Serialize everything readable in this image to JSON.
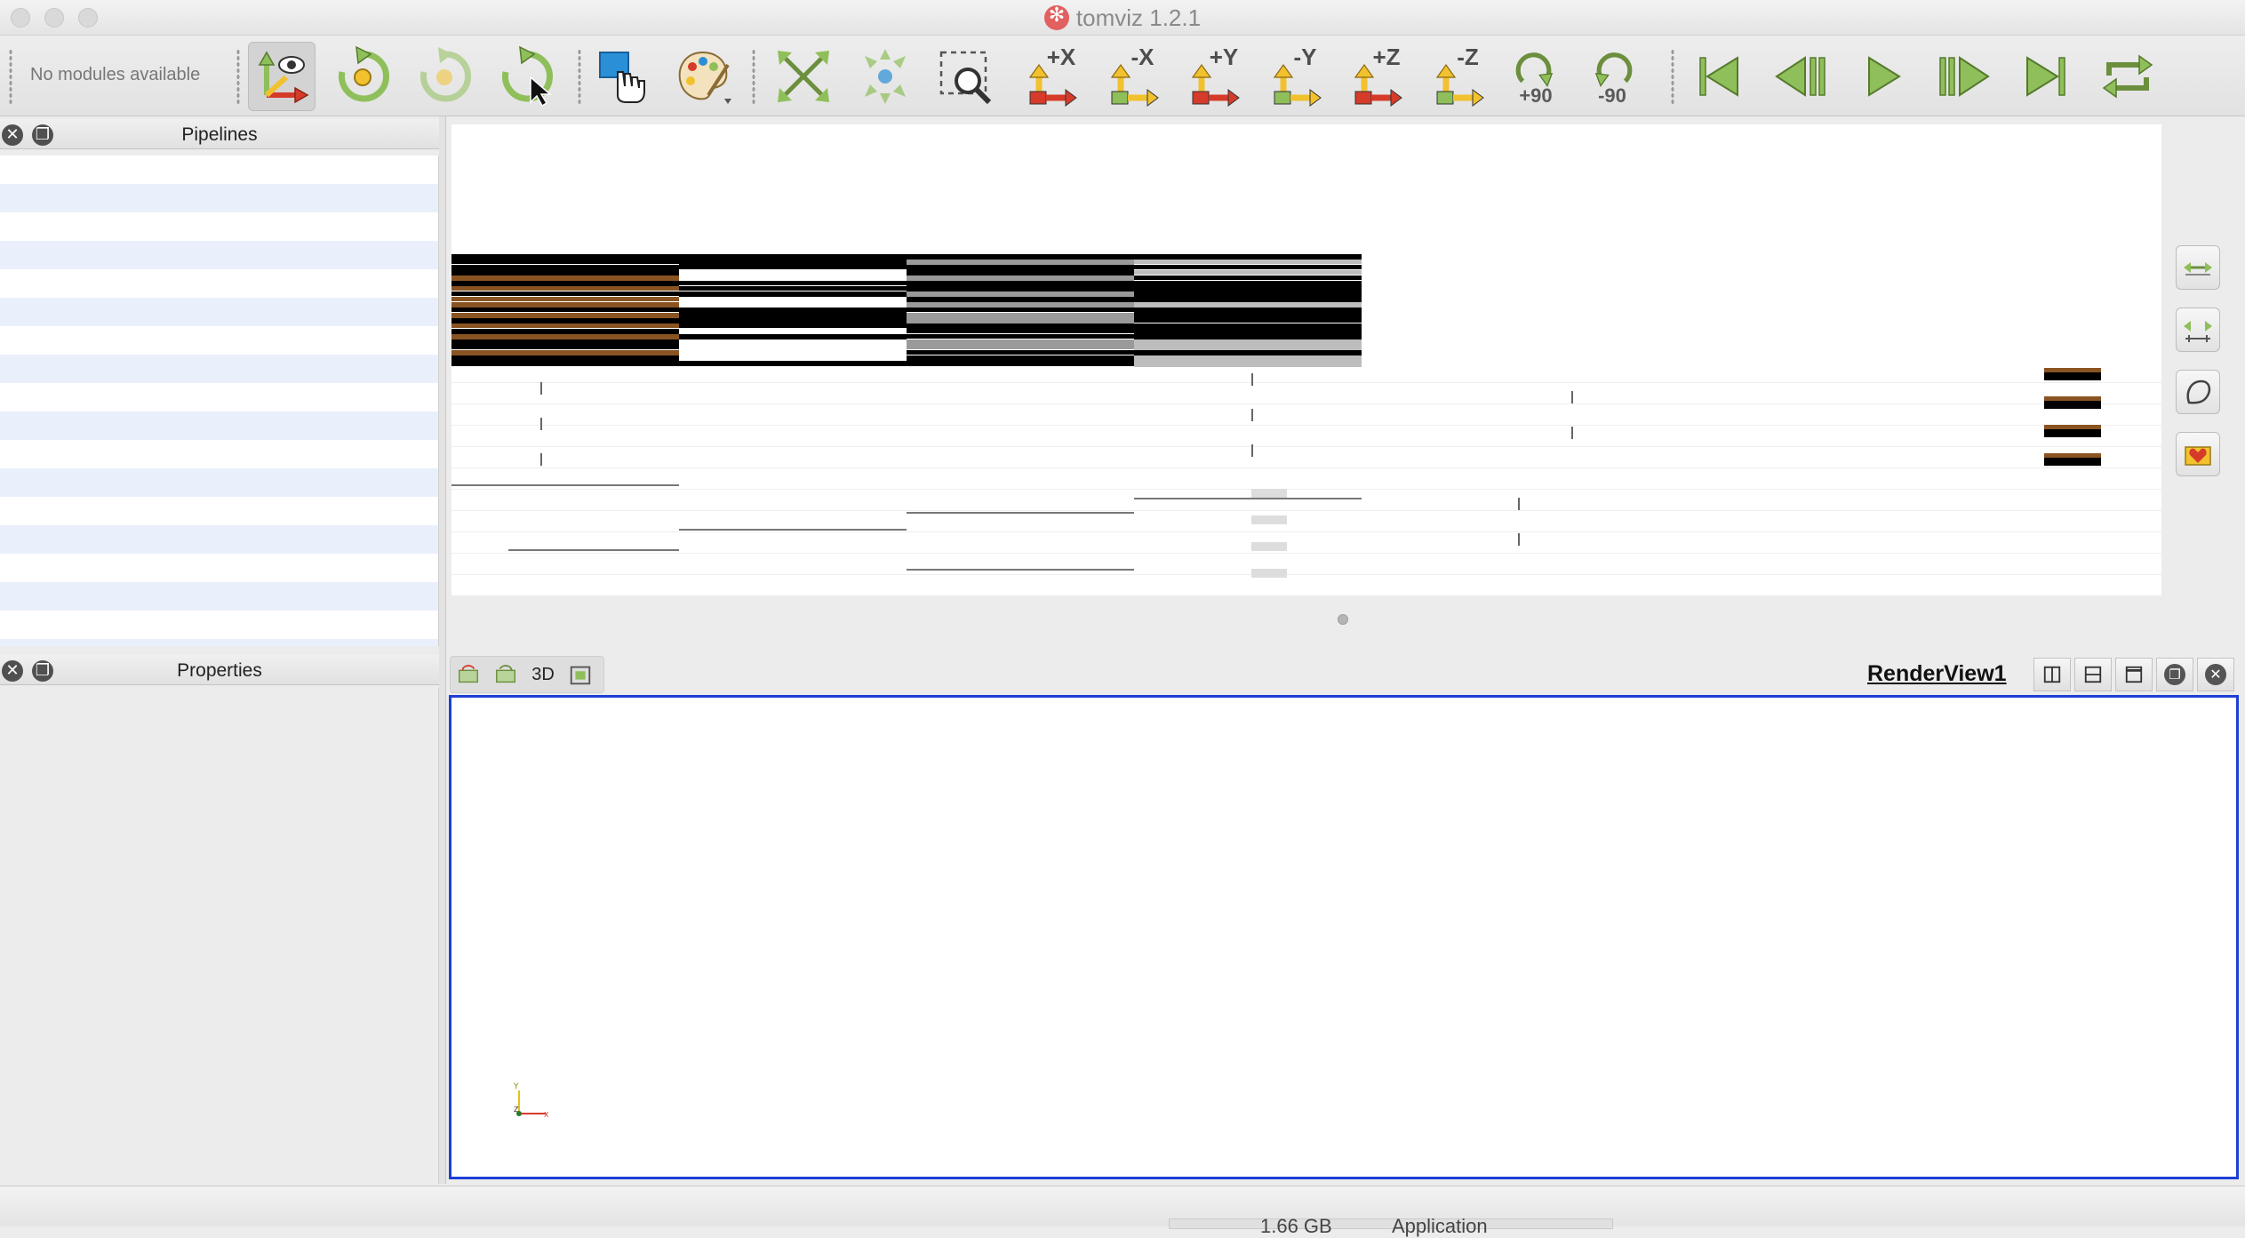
{
  "window": {
    "title": "tomviz 1.2.1"
  },
  "toolbar": {
    "modules_label": "No modules available",
    "buttons": [
      {
        "name": "Interact",
        "icon": "eye-axes-icon"
      },
      {
        "name": "Reset camera",
        "icon": "reset-camera-icon"
      },
      {
        "name": "Reset center",
        "icon": "reset-center-icon"
      },
      {
        "name": "Pick center",
        "icon": "pick-center-icon"
      },
      {
        "name": "Select",
        "icon": "select-hand-icon"
      },
      {
        "name": "Color map",
        "icon": "palette-icon"
      },
      {
        "name": "Zoom to data",
        "icon": "zoom-to-data-icon"
      },
      {
        "name": "Center on data",
        "icon": "center-data-icon"
      },
      {
        "name": "Zoom to box",
        "icon": "zoom-box-icon"
      }
    ],
    "view_direction_labels": [
      "+X",
      "-X",
      "+Y",
      "-Y",
      "+Z",
      "-Z"
    ],
    "rotate_cw_label": "+90",
    "rotate_ccw_label": "-90",
    "animation_buttons": [
      "first-frame",
      "previous-frame",
      "play",
      "next-frame",
      "last-frame",
      "loop"
    ]
  },
  "pipelines": {
    "title": "Pipelines"
  },
  "properties": {
    "title": "Properties"
  },
  "render_view": {
    "title": "RenderView1",
    "mode_label": "3D"
  },
  "statusbar": {
    "memory": "1.66 GB",
    "memory_label": "Application"
  },
  "colors": {
    "render_border": "#1d3fd6",
    "pipeline_alt_row": "#eaf0fb",
    "axis_arrow_yellow": "#f2c12e",
    "axis_arrow_red": "#d63b2a",
    "icon_green": "#8fbf5a"
  }
}
